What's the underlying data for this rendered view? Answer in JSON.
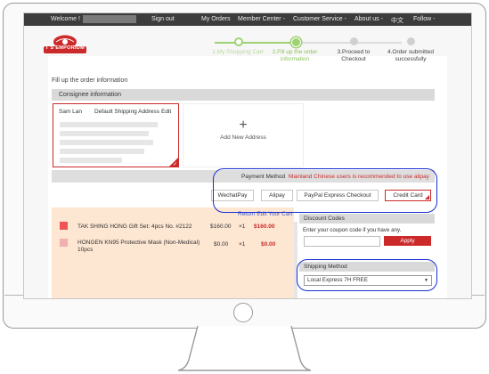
{
  "topbar": {
    "welcome": "Welcome !",
    "signout": "Sign out",
    "my_orders": "My Orders",
    "member_center": "Member Center -",
    "customer_service": "Customer Service -",
    "about_us": "About us -",
    "language": "中文",
    "follow": "Follow -"
  },
  "logo": {
    "brand": "T S EMPORIUM"
  },
  "steps": [
    {
      "label": "1.My Shopping Cart"
    },
    {
      "label": "2.Fill up the order information"
    },
    {
      "label": "3.Proceed to Checkout"
    },
    {
      "label": "4.Order submitted successfully"
    }
  ],
  "page": {
    "title": "Fill up the order information"
  },
  "consignee": {
    "header": "Consignee information",
    "name": "Sam Lan",
    "default_label": "Default Shipping Address",
    "edit": "Edit",
    "add_new": "Add New Address",
    "plus": "+"
  },
  "payment": {
    "label": "Payment Method",
    "note": "Mainland Chinese users is recommended to use alipay",
    "methods": [
      "WechatPay",
      "Alipay",
      "PayPal Express Checkout",
      "Credit Card"
    ],
    "selected": "Credit Card"
  },
  "cart": {
    "return_link": "Return Edit Your Cart",
    "items": [
      {
        "name": "TAK SHING HONG Gift Set: 4pcs No. #2122",
        "price": "$160.00",
        "qty": "×1",
        "total": "$160.00"
      },
      {
        "name": "HONGEN KN95 Protective Mask (Non-Medical) 10pcs",
        "price": "$0.00",
        "qty": "×1",
        "total": "$0.00"
      }
    ]
  },
  "discount": {
    "header": "Discount Codes",
    "prompt": "Enter your coupon code if you have any.",
    "apply": "Apply"
  },
  "shipping": {
    "header": "Shipping Method",
    "selected": "Local Express 7H FREE",
    "arrow": "▼"
  },
  "colors": {
    "accent_red": "#cc2a2a",
    "step_green": "#9fd273",
    "annotation_blue": "#1a2fd1"
  }
}
